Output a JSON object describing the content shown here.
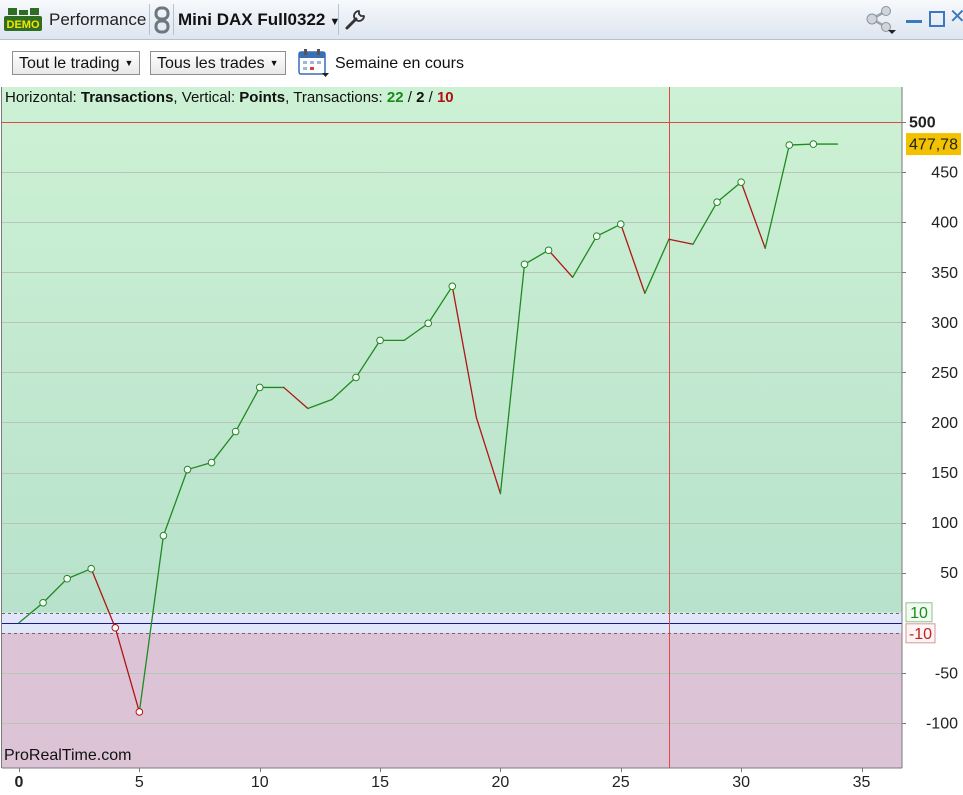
{
  "app": {
    "badge": "DEMO",
    "title": "Performance",
    "instrument": "Mini DAX Full0322"
  },
  "toolbar": {
    "scope": "Tout le trading",
    "trades": "Tous les trades",
    "period": "Semaine en cours"
  },
  "header": {
    "horizontal_label": "Horizontal:",
    "horizontal_value": "Transactions",
    "vertical_label": "Vertical:",
    "vertical_value": "Points",
    "transactions_label": "Transactions:",
    "winning": "22",
    "neutral": "2",
    "losing": "10"
  },
  "watermark": "ProRealTime.com",
  "colors": {
    "gain_line": "#1f8a1f",
    "loss_line": "#b01515",
    "positive_zone": "#c8eed2",
    "negative_zone": "#dcc4d6",
    "neutral_band": "#e2e6fb",
    "price_tag": "#f2c200",
    "crosshair": "#e04848"
  },
  "chart_data": {
    "type": "line",
    "xlabel": "Transactions",
    "ylabel": "Points",
    "x": [
      0,
      1,
      2,
      3,
      4,
      5,
      6,
      7,
      8,
      9,
      10,
      11,
      12,
      13,
      14,
      15,
      16,
      17,
      18,
      19,
      20,
      21,
      22,
      23,
      24,
      25,
      26,
      27,
      28,
      29,
      30,
      31,
      32,
      33,
      34
    ],
    "y": [
      0,
      20,
      44,
      54,
      -5,
      -89,
      87,
      153,
      160,
      191,
      235,
      235,
      214,
      223,
      245,
      282,
      282,
      299,
      336,
      205,
      129,
      358,
      372,
      345,
      386,
      398,
      329,
      383,
      378,
      420,
      440,
      374,
      477,
      478,
      478
    ],
    "markers": [
      1,
      2,
      3,
      4,
      5,
      6,
      7,
      8,
      9,
      10,
      14,
      15,
      17,
      18,
      21,
      22,
      24,
      25,
      29,
      30,
      32,
      33
    ],
    "xlim": [
      0,
      36
    ],
    "ylim": [
      -145,
      535
    ],
    "x_ticks": [
      "0",
      "5",
      "10",
      "15",
      "20",
      "25",
      "30",
      "35"
    ],
    "y_ticks": [
      "-100",
      "-50",
      "50",
      "100",
      "150",
      "200",
      "250",
      "300",
      "350",
      "400",
      "450",
      "500"
    ],
    "band": {
      "upper": 10,
      "lower": -10,
      "upper_label": "10",
      "lower_label": "-10"
    },
    "crosshair": {
      "x": 27,
      "y": 500,
      "y_label": "500"
    },
    "last_value": "477,78",
    "grid": true,
    "legend": "none"
  }
}
